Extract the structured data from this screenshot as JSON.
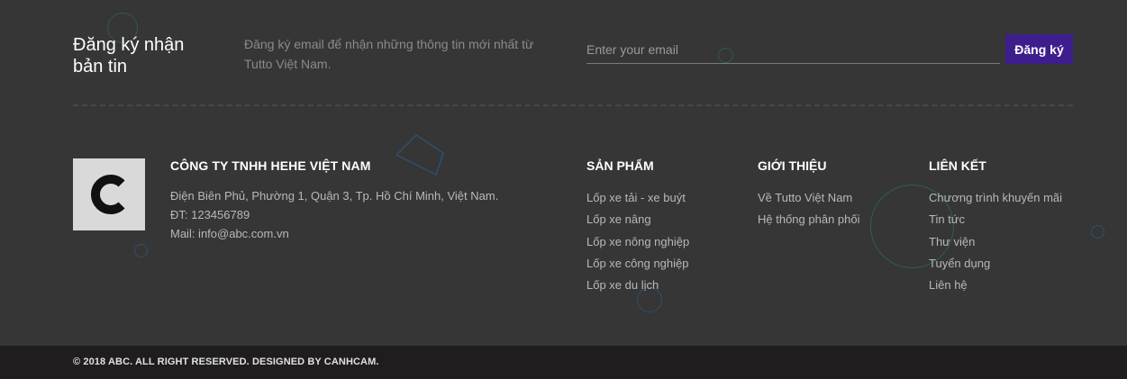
{
  "newsletter": {
    "title": "Đăng ký nhận bản tin",
    "description": "Đăng ký email để nhận những thông tin mới nhất từ Tutto Việt Nam.",
    "email_placeholder": "Enter your email",
    "email_value": "",
    "subscribe_label": "Đăng ký"
  },
  "company": {
    "logo_letter": "C",
    "name": "CÔNG TY TNHH HEHE VIỆT NAM",
    "address": "Điện Biên Phủ, Phường 1, Quận 3, Tp. Hồ Chí Minh, Việt Nam.",
    "phone": "ĐT: 123456789",
    "email": "Mail: info@abc.com.vn"
  },
  "columns": [
    {
      "title": "SẢN PHẨM",
      "items": [
        "Lốp xe tải - xe buýt",
        "Lốp xe nâng",
        "Lốp xe nông nghiệp",
        "Lốp xe công nghiệp",
        "Lốp xe du lịch"
      ]
    },
    {
      "title": "GIỚI THIỆU",
      "items": [
        "Về Tutto Việt Nam",
        "Hệ thống phân phối"
      ]
    },
    {
      "title": "LIÊN KẾT",
      "items": [
        "Chương trình khuyến mãi",
        "Tin tức",
        "Thư viện",
        "Tuyển dụng",
        "Liên hệ"
      ]
    }
  ],
  "footer": {
    "copyright": "© 2018 ABC. ALL RIGHT RESERVED. DESIGNED BY CANHCAM."
  },
  "colors": {
    "background": "#363636",
    "bottom_bar": "#1f1d1e",
    "accent_button": "#3e1e8c",
    "deco_green": "#2f5e4f",
    "deco_blue": "#2f4f6f"
  }
}
